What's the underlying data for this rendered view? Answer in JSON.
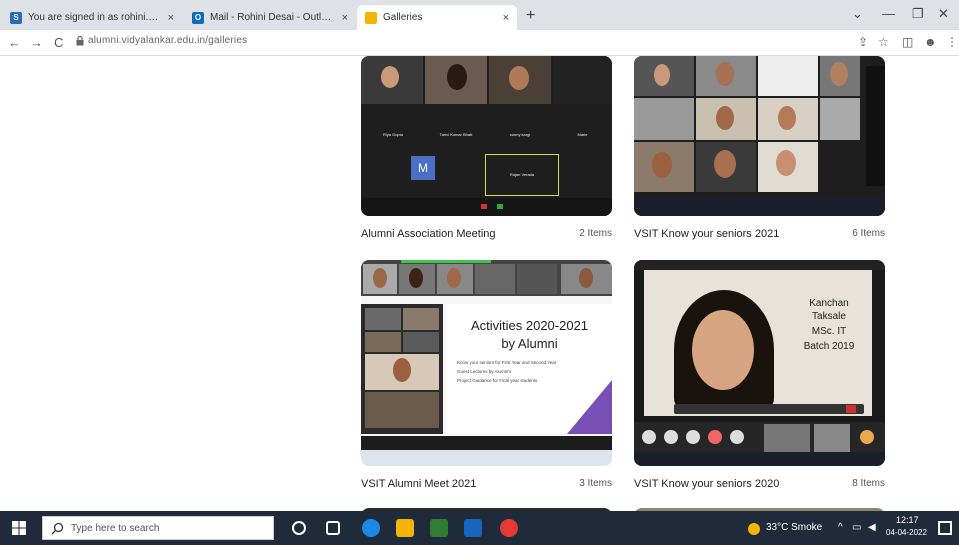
{
  "tabs": [
    {
      "title": "You are signed in as rohini.gaikw",
      "close": "×"
    },
    {
      "title": "Mail - Rohini Desai - Outlook",
      "close": "×"
    },
    {
      "title": "Galleries",
      "close": "×"
    }
  ],
  "newtab": "+",
  "window_controls": {
    "chevron": "⌄",
    "minimize": "—",
    "restore": "❐",
    "close": "✕"
  },
  "nav": {
    "back": "←",
    "forward": "→",
    "reload": "C"
  },
  "address": {
    "url": "alumni.vidyalankar.edu.in/galleries"
  },
  "toolbar_icons": [
    "⇪",
    "☆",
    "◫",
    "☻",
    "⋮"
  ],
  "galleries": [
    {
      "title": "Alumni Association Meeting",
      "count": "2 Items"
    },
    {
      "title": "VSIT Know your seniors 2021",
      "count": "6 Items"
    },
    {
      "title": "VSIT Alumni Meet 2021",
      "count": "3 Items"
    },
    {
      "title": "VSIT Know your seniors 2020",
      "count": "8 Items"
    }
  ],
  "thumb_texts": {
    "activities_title": "Activities 2020-2021",
    "activities_subtitle": "by Alumni",
    "activities_bullets": [
      "Know your seniors for First Year and Second Year",
      "Guest Lectures by Alumni's",
      "Project Guidance for Final year students"
    ],
    "m_avatar": "M",
    "kanchan_name1": "Kanchan",
    "kanchan_name2": "Taksale",
    "kanchan_degree": "MSc. IT",
    "kanchan_batch": "Batch 2019",
    "meeting_names": [
      "Riya Gupta",
      "Tanvi Kumar Bhatt",
      "sunny kargi",
      "Marie",
      "Rajan Verada"
    ]
  },
  "taskbar": {
    "search_placeholder": "Type here to search",
    "weather": "33°C  Smoke",
    "tray_caret": "^",
    "time": "12:17",
    "date": "04-04-2022"
  },
  "colors": {
    "tabstrip": "#dee1e6",
    "taskbar": "#1f2a3a",
    "meeting_bg": "#1e1e1e",
    "purple": "#7a4fb5"
  }
}
